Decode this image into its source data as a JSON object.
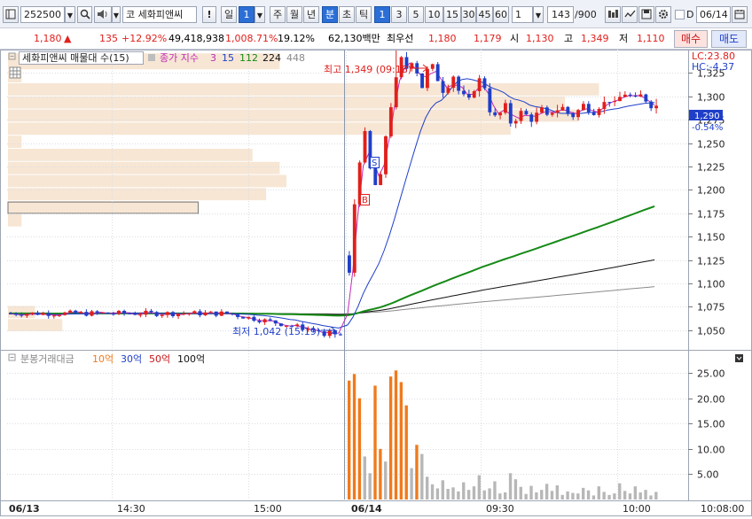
{
  "toolbar": {
    "stock_code": "252500",
    "market_prefix": "코",
    "stock_name": "세화피앤씨",
    "alert_label": "!",
    "period_day": "일",
    "period_value": "1",
    "period_week": "주",
    "period_month": "월",
    "period_year": "년",
    "period_minute": "분",
    "period_second": "초",
    "period_tick": "틱",
    "intervals": [
      "1",
      "3",
      "5",
      "10",
      "15",
      "30",
      "45",
      "60"
    ],
    "multiplier": "1",
    "count_current": "143",
    "count_total": "/900",
    "date_checkbox_label": "D",
    "date_value": "06/14"
  },
  "quote": {
    "price": "1,180",
    "change_arrow": "▲",
    "change": "135",
    "change_pct": "+12.92%",
    "volume": "49,418,938",
    "volume_ratio": "1,008.71%",
    "turnover_rate": "19.12%",
    "trade_value": "62,130백만",
    "best_bid_label": "최우선",
    "best_ask": "1,180",
    "best_bid": "1,179",
    "open_label": "시",
    "open": "1,130",
    "high_label": "고",
    "high": "1,349",
    "low_label": "저",
    "low": "1,110",
    "buy_label": "매수",
    "sell_label": "매도"
  },
  "price_panel": {
    "legend_stock": "세화피앤씨 매물대 수(15)",
    "legend_ma_label": "종가 지수",
    "legend_ma_periods": [
      "3",
      "15",
      "112",
      "224",
      "448"
    ],
    "lc_label": "LC:23.80",
    "hc_label": "HC:-4.37",
    "high_annotation": "최고 1,349 (09:18)",
    "low_annotation": "최저 1,042 (15:19)",
    "last_price_tag": "1,290",
    "last_change_tag": "-0.54%",
    "buy_signal": "B",
    "sell_signal": "S"
  },
  "volume_panel": {
    "legend_title": "분봉거래대금",
    "legend_levels": [
      "10억",
      "30억",
      "50억",
      "100억"
    ]
  },
  "x_axis": {
    "labels": [
      "06/13",
      "14:30",
      "15:00",
      "06/14",
      "09:30",
      "10:00",
      "10:08:00"
    ]
  },
  "colors": {
    "up": "#e0201c",
    "down": "#1f3fc8",
    "ma3": "#c02ab4",
    "ma15": "#1f3fc8",
    "ma112": "#168a16",
    "ma224": "#111111",
    "ma448": "#8a8a8a",
    "vol_high": "#f07a1c",
    "vol_low": "#b7b7b7",
    "volume_profile": "#f7e6d4"
  },
  "chart_data": [
    {
      "type": "candlestick",
      "y_ticks": [
        1050,
        1075,
        1100,
        1125,
        1150,
        1175,
        1200,
        1225,
        1250,
        1275,
        1300,
        1325
      ],
      "ylim": [
        1030,
        1350
      ],
      "x_start": "06/13",
      "x_end": "10:08:00",
      "day_change_at": "06/14",
      "prev_close": 1045,
      "day_high": 1349,
      "day_high_time": "09:18",
      "day_low": 1042,
      "day_low_time": "15:19",
      "last_price": 1290,
      "grid": true,
      "volume_profile_ranges": [
        [
          1328,
          1346
        ],
        [
          1314,
          1328
        ],
        [
          1300,
          1314
        ],
        [
          1286,
          1300
        ],
        [
          1272,
          1286
        ],
        [
          1258,
          1272
        ],
        [
          1244,
          1258
        ],
        [
          1230,
          1244
        ],
        [
          1216,
          1230
        ],
        [
          1202,
          1216
        ],
        [
          1188,
          1202
        ],
        [
          1174,
          1188
        ],
        [
          1160,
          1174
        ],
        [
          1062,
          1076
        ],
        [
          1048,
          1062
        ]
      ],
      "volume_profile_sizes": [
        0.4,
        0.02,
        0.87,
        0.82,
        0.84,
        0.74,
        0.02,
        0.36,
        0.4,
        0.41,
        0.38,
        0.28,
        0.02,
        0.04,
        0.08
      ]
    },
    {
      "type": "bar",
      "y_ticks": [
        5,
        10,
        15,
        20,
        25
      ],
      "ylim": [
        0,
        28
      ],
      "y_tick_format": "0.00",
      "grid": true
    }
  ]
}
